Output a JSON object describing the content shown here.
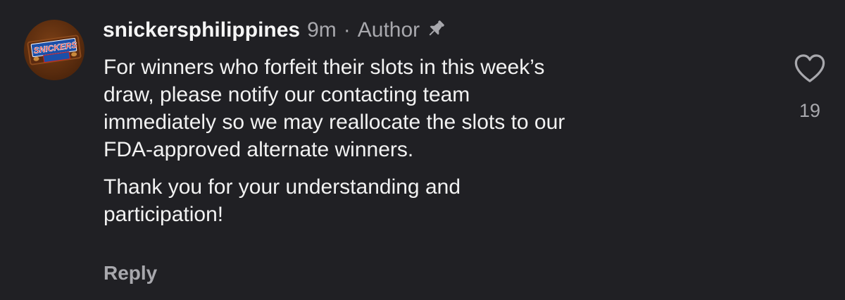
{
  "comment": {
    "username": "snickersphilippines",
    "time": "9m",
    "separator": "·",
    "role": "Author",
    "pinned_icon": "pin-icon",
    "avatar_icon": "snickers-logo",
    "avatar_text": "SNICKERS",
    "paragraphs": [
      "For winners who forfeit their slots in this week’s\ndraw, please notify our contacting team\nimmediately so we may reallocate the slots to our\nFDA-approved alternate winners.",
      "Thank you for your understanding and\nparticipation!"
    ],
    "reply_label": "Reply",
    "like_icon": "heart-icon",
    "like_count": "19"
  },
  "colors": {
    "background": "#202024",
    "primary_text": "#f2f2f2",
    "secondary_text": "#a8a8ad",
    "brand_blue": "#1c4fa8",
    "brand_brown": "#5b2a10"
  }
}
